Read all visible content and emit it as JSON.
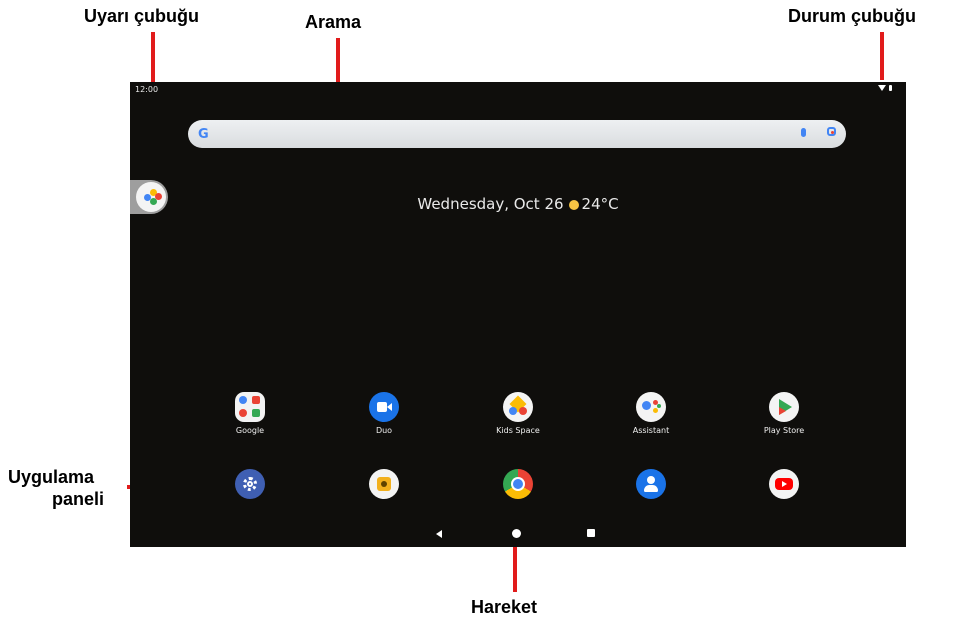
{
  "callouts": {
    "notification_bar": "Uyarı çubuğu",
    "search": "Arama",
    "status_bar": "Durum çubuğu",
    "app_panel_line1": "Uygulama",
    "app_panel_line2": "paneli",
    "gesture": "Hareket"
  },
  "screen": {
    "time": "12:00",
    "search_logo": "G",
    "date_text": "Wednesday, Oct 26",
    "temperature": "24°C",
    "apps_row": [
      {
        "label": "Google",
        "icon": "google-folder-icon"
      },
      {
        "label": "Duo",
        "icon": "duo-icon"
      },
      {
        "label": "Kids Space",
        "icon": "kids-space-icon"
      },
      {
        "label": "Assistant",
        "icon": "assistant-icon"
      },
      {
        "label": "Play Store",
        "icon": "play-store-icon"
      }
    ],
    "dock": [
      {
        "icon": "settings-icon"
      },
      {
        "icon": "camera-icon"
      },
      {
        "icon": "chrome-icon"
      },
      {
        "icon": "contacts-icon"
      },
      {
        "icon": "youtube-icon"
      }
    ]
  },
  "colors": {
    "callout_line": "#e11b1b",
    "screen_bg": "#0f0e0c",
    "accent_blue": "#4285f4"
  }
}
